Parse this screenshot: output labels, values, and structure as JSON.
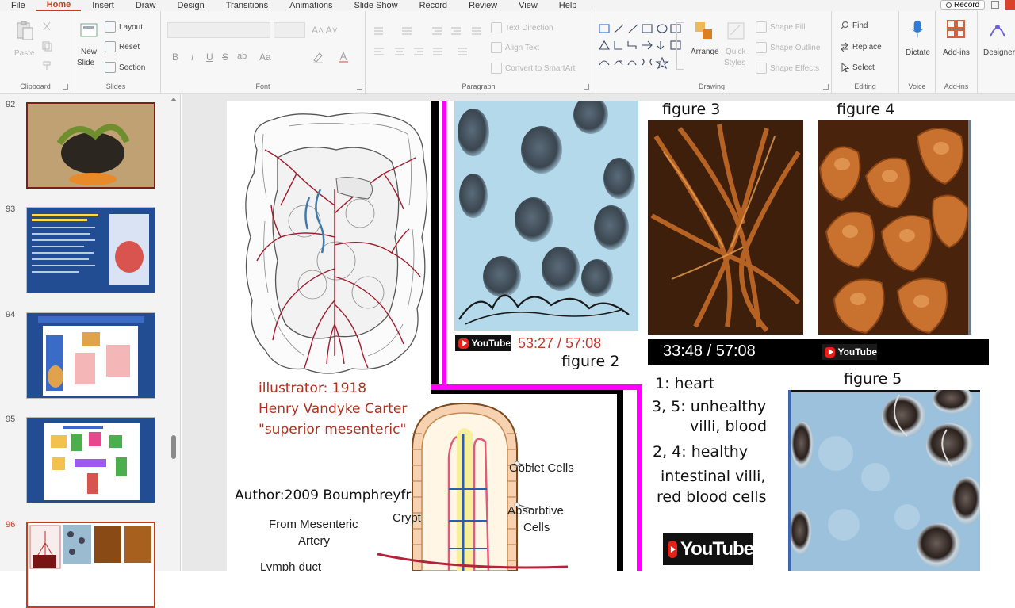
{
  "menu": {
    "tabs": [
      "File",
      "Home",
      "Insert",
      "Draw",
      "Design",
      "Transitions",
      "Animations",
      "Slide Show",
      "Record",
      "Review",
      "View",
      "Help"
    ],
    "active_tab": "Home",
    "record_button": "Record"
  },
  "ribbon": {
    "clipboard": {
      "label": "Clipboard",
      "paste": "Paste"
    },
    "slides": {
      "label": "Slides",
      "new_slide": "New",
      "new_slide_sub": "Slide",
      "layout": "Layout",
      "reset": "Reset",
      "section": "Section"
    },
    "font": {
      "label": "Font",
      "bold": "B",
      "italic": "I",
      "underline": "U",
      "strike": "S",
      "spacing": "ab",
      "case": "Aa"
    },
    "paragraph": {
      "label": "Paragraph",
      "text_direction": "Text Direction",
      "align_text": "Align Text",
      "smartart": "Convert to SmartArt"
    },
    "drawing": {
      "label": "Drawing",
      "arrange": "Arrange",
      "quick_styles": "Quick",
      "quick_styles_sub": "Styles",
      "shape_fill": "Shape Fill",
      "shape_outline": "Shape Outline",
      "shape_effects": "Shape Effects"
    },
    "editing": {
      "label": "Editing",
      "find": "Find",
      "replace": "Replace",
      "select": "Select"
    },
    "voice": {
      "label": "Voice",
      "dictate": "Dictate"
    },
    "addins": {
      "label": "Add-ins",
      "addins": "Add-ins"
    },
    "designer": {
      "designer": "Designer"
    }
  },
  "thumbnails": [
    {
      "number": "92",
      "active": false
    },
    {
      "number": "93",
      "active": false
    },
    {
      "number": "94",
      "active": false
    },
    {
      "number": "95",
      "active": false
    },
    {
      "number": "96",
      "active": true
    }
  ],
  "slide": {
    "figure2": {
      "timestamp": "53:27 / 57:08",
      "caption": "figure 2",
      "yt_label": "YouTube"
    },
    "figure3": {
      "caption": "figure 3"
    },
    "figure4": {
      "caption": "figure 4",
      "timestamp": "33:48 / 57:08",
      "yt_label": "YouTube"
    },
    "figure5": {
      "caption": "figure 5"
    },
    "illustrator": {
      "line1": "illustrator: 1918",
      "line2": "Henry Vandyke Carter",
      "line3": "\"superior mesenteric\""
    },
    "author": "Author:2009  Boumphreyfr",
    "villus_labels": {
      "goblet": "Goblet Cells",
      "absorptive1": "Absorbtive",
      "absorptive2": "Cells",
      "crypt": "Crypt",
      "from1": "From Mesenteric",
      "from2": "Artery",
      "lymph": "Lymph duct"
    },
    "legend": {
      "l1": "1: heart",
      "l2": "3, 5: unhealthy",
      "l3": "villi, blood",
      "l4": "2, 4: healthy",
      "l5": "intestinal villi,",
      "l6": "red blood cells"
    },
    "youtube_logo": "YouTube"
  },
  "colors": {
    "accent": "#c43e1c",
    "magenta": "#ff00ff",
    "caption_red": "#b0301d",
    "youtube_red": "#e62117"
  }
}
